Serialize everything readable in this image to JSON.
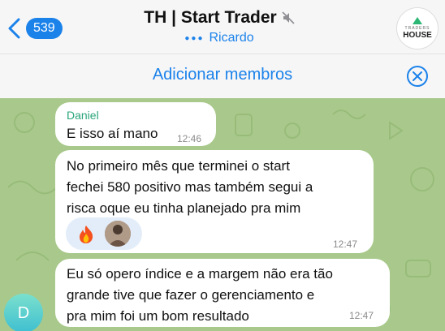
{
  "header": {
    "back_count": "539",
    "title": "TH | Start Trader",
    "typing_user": "Ricardo",
    "logo_small": "TRADERS",
    "logo_big": "HOUSE"
  },
  "addbar": {
    "label": "Adicionar membros"
  },
  "messages": [
    {
      "sender": "Daniel",
      "text": "E isso aí mano",
      "time": "12:46"
    },
    {
      "text_lines": [
        "No primeiro mês que terminei o start",
        "fechei 580 positivo mas também segui a",
        "risca oque eu tinha planejado pra mim"
      ],
      "time": "12:47",
      "reaction": "fire-emoji"
    },
    {
      "text_lines": [
        "Eu só opero índice e a margem não era tão",
        "grande tive que fazer o gerenciamento e",
        "pra mim foi um bom resultado"
      ],
      "time": "12:47"
    }
  ],
  "sender_avatar_initial": "D",
  "colors": {
    "accent": "#1b82ea",
    "chat_bg": "#a8c98b",
    "sender_name": "#2aa67a",
    "reaction_bg": "#e3edf9"
  }
}
